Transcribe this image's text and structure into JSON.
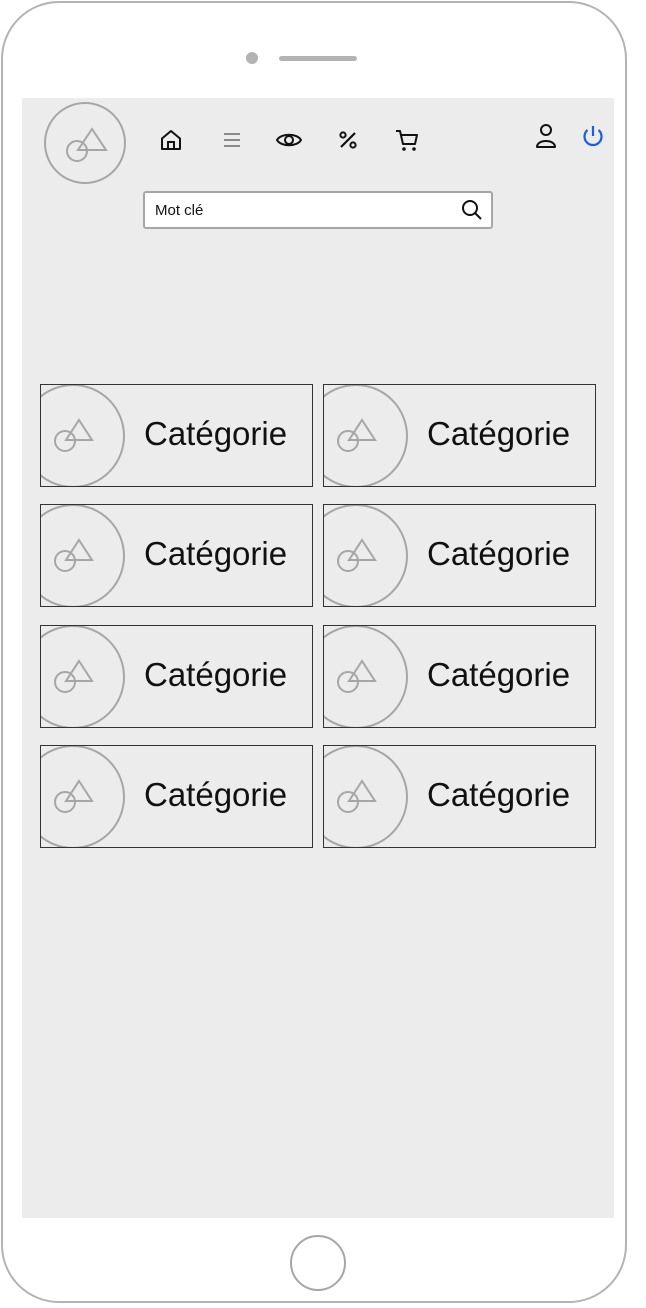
{
  "header": {
    "nav_icons": [
      "home-icon",
      "menu-icon",
      "eye-icon",
      "percent-icon",
      "cart-icon"
    ],
    "right_icons": [
      "user-icon",
      "power-icon"
    ],
    "power_color": "#1a5ce6"
  },
  "search": {
    "value": "Mot clé",
    "icon": "search-icon"
  },
  "categories": [
    {
      "label": "Catégorie"
    },
    {
      "label": "Catégorie"
    },
    {
      "label": "Catégorie"
    },
    {
      "label": "Catégorie"
    },
    {
      "label": "Catégorie"
    },
    {
      "label": "Catégorie"
    },
    {
      "label": "Catégorie"
    },
    {
      "label": "Catégorie"
    }
  ]
}
